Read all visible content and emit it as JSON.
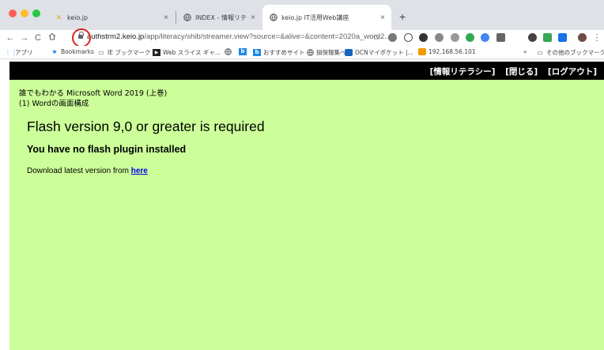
{
  "tabs": [
    {
      "title": "keio.jp",
      "close": "×",
      "favicon": "keio-logo-icon",
      "color": "#f0a030"
    },
    {
      "title": "INDEX - 情報リテラシー",
      "close": "×",
      "favicon": "globe-icon"
    },
    {
      "title": "keio.jp IT活用Web講座",
      "close": "×",
      "favicon": "globe-icon",
      "active": true
    }
  ],
  "new_tab": "+",
  "toolbar": {
    "url_host": "authstrm2.keio.jp",
    "url_path": "/app/literacy/shib/streamer.view?source=&alive=&content=2020a_word2...",
    "star": "☆"
  },
  "bookmarks": [
    {
      "label": "アプリ",
      "icon": "apps-grid-icon"
    },
    {
      "label": "Bookmarks",
      "icon": "star-icon"
    },
    {
      "label": "IE ブックマーク",
      "icon": "folder-icon"
    },
    {
      "label": "Web スライス ギャ...",
      "icon": "web-slice-icon"
    },
    {
      "label": "",
      "icon": "globe-icon"
    },
    {
      "label": "",
      "icon": "b-logo-icon"
    },
    {
      "label": "おすすめサイト",
      "icon": "b-logo-icon"
    },
    {
      "label": "損保報集へ",
      "icon": "globe-icon"
    },
    {
      "label": "OCNマイポケット |...",
      "icon": "ocn-icon"
    },
    {
      "label": "192.168.56.101",
      "icon": "bookmark-page-icon"
    },
    {
      "label": "»",
      "icon": ""
    },
    {
      "label": "その他のブックマーク",
      "icon": "folder-icon"
    }
  ],
  "page": {
    "top_links": [
      "[情報リテラシー]",
      "[閉じる]",
      "[ログアウト]"
    ],
    "breadcrumb_line1": "誰でもわかる Microsoft Word 2019 (上巻)",
    "breadcrumb_line2": "(1) Wordの画面構成",
    "heading": "Flash version 9,0 or greater is required",
    "subheading": "You have no flash plugin installed",
    "download_text": "Download latest version from ",
    "download_link": "here",
    "bg_color": "#ccff99"
  }
}
